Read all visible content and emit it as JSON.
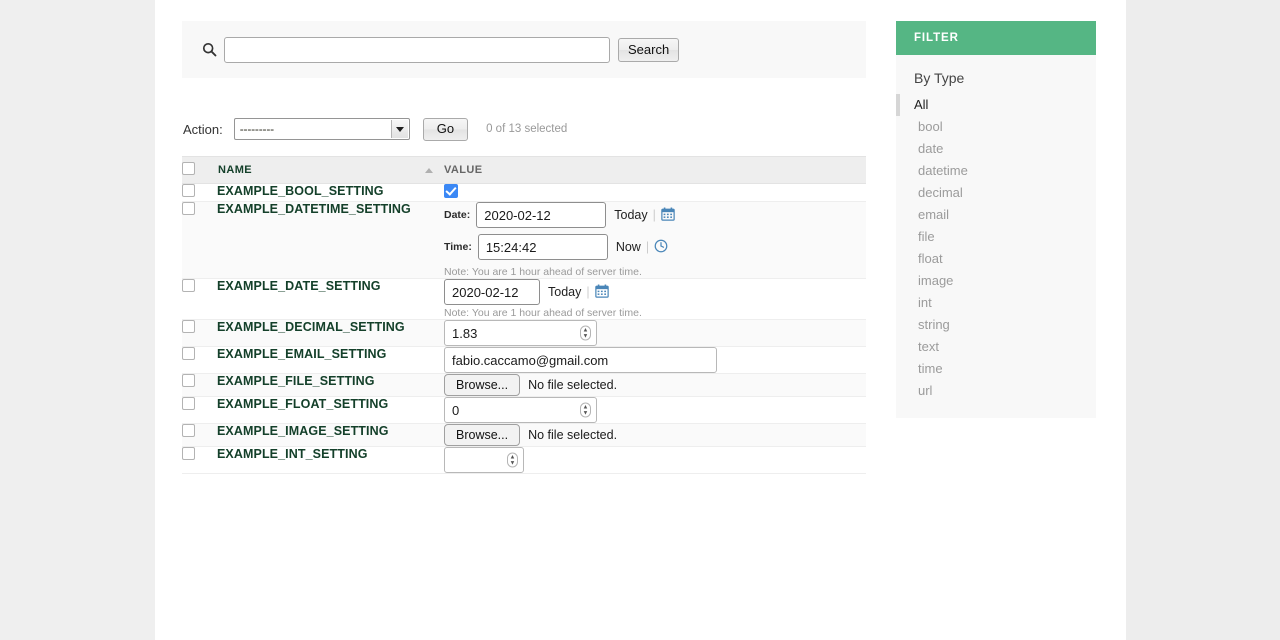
{
  "search": {
    "icon": "search-icon",
    "value": "",
    "placeholder": "",
    "submit_label": "Search"
  },
  "actions": {
    "label": "Action:",
    "selected": "---------",
    "options": [
      "---------"
    ],
    "go_label": "Go",
    "selection_count": "0 of 13 selected"
  },
  "table": {
    "columns": [
      "NAME",
      "VALUE"
    ],
    "sort_column": "NAME",
    "sort_direction": "asc",
    "rows": [
      {
        "name": "EXAMPLE_BOOL_SETTING",
        "type": "bool",
        "checked": true,
        "selected": false
      },
      {
        "name": "EXAMPLE_DATETIME_SETTING",
        "type": "datetime",
        "date_label": "Date:",
        "date_value": "2020-02-12",
        "date_today_label": "Today",
        "date_icon": "calendar-icon",
        "time_label": "Time:",
        "time_value": "15:24:42",
        "time_now_label": "Now",
        "time_icon": "clock-icon",
        "note": "Note: You are 1 hour ahead of server time.",
        "selected": false
      },
      {
        "name": "EXAMPLE_DATE_SETTING",
        "type": "date",
        "date_value": "2020-02-12",
        "date_today_label": "Today",
        "date_icon": "calendar-icon",
        "note": "Note: You are 1 hour ahead of server time.",
        "selected": false
      },
      {
        "name": "EXAMPLE_DECIMAL_SETTING",
        "type": "decimal",
        "value": "1.83",
        "selected": false
      },
      {
        "name": "EXAMPLE_EMAIL_SETTING",
        "type": "email",
        "value": "fabio.caccamo@gmail.com",
        "selected": false
      },
      {
        "name": "EXAMPLE_FILE_SETTING",
        "type": "file",
        "browse_label": "Browse...",
        "file_status": "No file selected.",
        "selected": false
      },
      {
        "name": "EXAMPLE_FLOAT_SETTING",
        "type": "float",
        "value": "0",
        "selected": false
      },
      {
        "name": "EXAMPLE_IMAGE_SETTING",
        "type": "image",
        "browse_label": "Browse...",
        "file_status": "No file selected.",
        "selected": false
      },
      {
        "name": "EXAMPLE_INT_SETTING",
        "type": "int",
        "value": "",
        "selected": false
      }
    ]
  },
  "filter": {
    "header": "FILTER",
    "title": "By Type",
    "accent_color": "#55b684",
    "items": [
      {
        "label": "All",
        "selected": true
      },
      {
        "label": "bool",
        "selected": false
      },
      {
        "label": "date",
        "selected": false
      },
      {
        "label": "datetime",
        "selected": false
      },
      {
        "label": "decimal",
        "selected": false
      },
      {
        "label": "email",
        "selected": false
      },
      {
        "label": "file",
        "selected": false
      },
      {
        "label": "float",
        "selected": false
      },
      {
        "label": "image",
        "selected": false
      },
      {
        "label": "int",
        "selected": false
      },
      {
        "label": "string",
        "selected": false
      },
      {
        "label": "text",
        "selected": false
      },
      {
        "label": "time",
        "selected": false
      },
      {
        "label": "url",
        "selected": false
      }
    ]
  }
}
